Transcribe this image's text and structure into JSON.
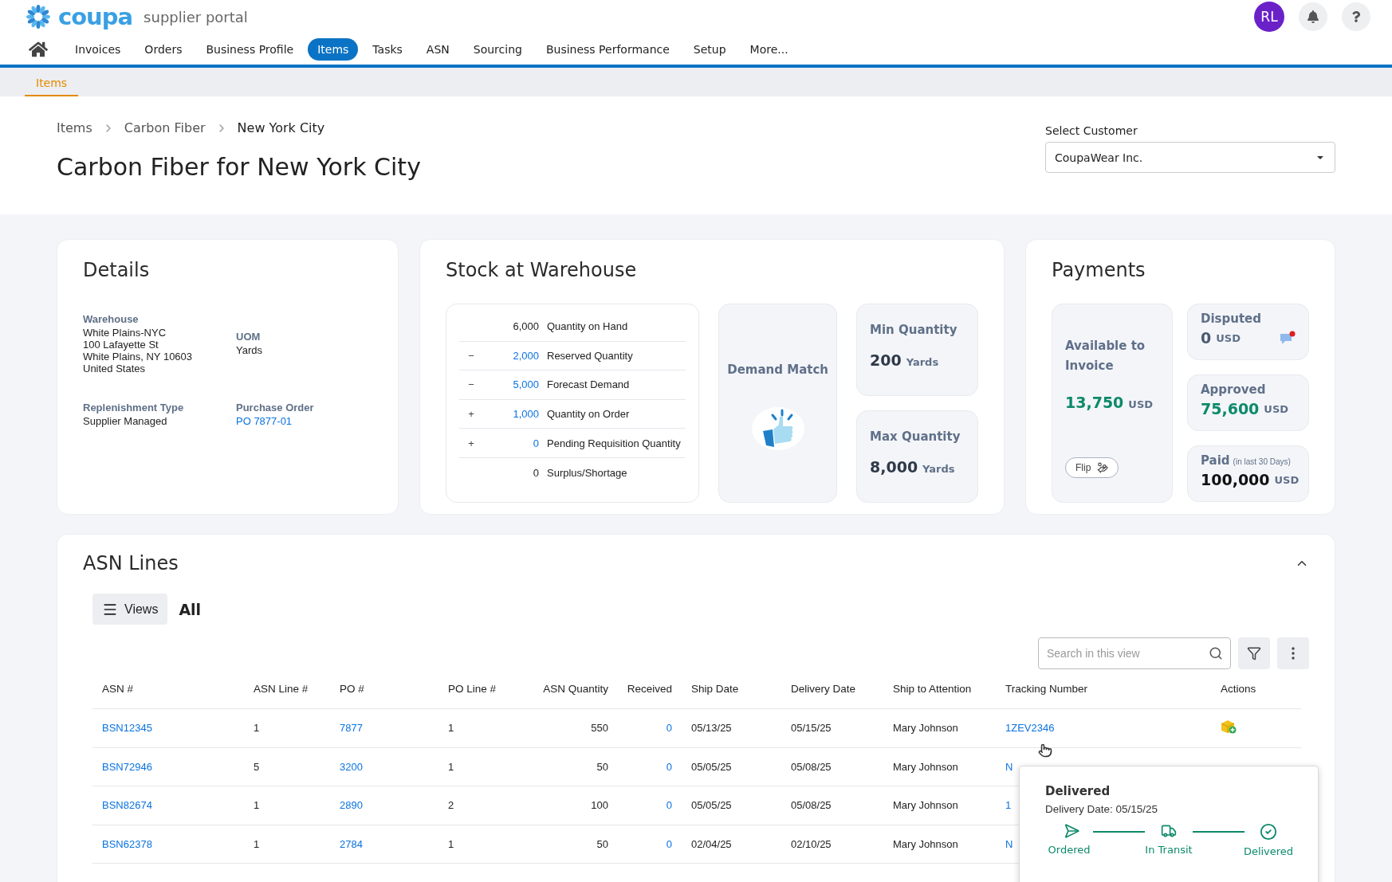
{
  "header": {
    "logo": "coupa",
    "product": "supplier portal",
    "avatar": "RL"
  },
  "nav": [
    {
      "label": "Invoices",
      "selected": false
    },
    {
      "label": "Orders",
      "selected": false
    },
    {
      "label": "Business Profile",
      "selected": false
    },
    {
      "label": "Items",
      "selected": true
    },
    {
      "label": "Tasks",
      "selected": false
    },
    {
      "label": "ASN",
      "selected": false
    },
    {
      "label": "Sourcing",
      "selected": false
    },
    {
      "label": "Business Performance",
      "selected": false
    },
    {
      "label": "Setup",
      "selected": false
    },
    {
      "label": "More...",
      "selected": false
    }
  ],
  "subnav": [
    {
      "label": "Items",
      "selected": true
    }
  ],
  "breadcrumbs": [
    "Items",
    "Carbon Fiber",
    "New York City"
  ],
  "title": "Carbon Fiber for New York City",
  "customer_select": {
    "label": "Select Customer",
    "value": "CoupaWear Inc."
  },
  "details": {
    "title": "Details",
    "fields": [
      {
        "label": "Warehouse",
        "kind": "text",
        "lines": [
          "White Plains-NYC",
          "100 Lafayette St",
          "White Plains, NY 10603",
          "United States"
        ]
      },
      {
        "label": "UOM",
        "kind": "text",
        "lines": [
          "Yards"
        ]
      },
      {
        "label": "Replenishment Type",
        "kind": "text",
        "lines": [
          "Supplier Managed"
        ]
      },
      {
        "label": "Purchase Order",
        "kind": "link",
        "lines": [
          "PO 7877-01"
        ]
      }
    ]
  },
  "stock": {
    "title": "Stock at Warehouse",
    "rows": [
      {
        "value": "6,000",
        "label": "Quantity on Hand",
        "kind": "plain"
      },
      {
        "sign": "−",
        "value": "2,000",
        "label": "Reserved Quantity",
        "kind": "link"
      },
      {
        "sign": "−",
        "value": "5,000",
        "label": "Forecast Demand",
        "kind": "link"
      },
      {
        "sign": "+",
        "value": "1,000",
        "label": "Quantity on Order",
        "kind": "link"
      },
      {
        "sign": "+",
        "value": "0",
        "label": "Pending Requisition Quantity",
        "kind": "link"
      },
      {
        "value": "0",
        "label": "Surplus/Shortage",
        "kind": "plain"
      }
    ],
    "demand_match": {
      "label": "Demand Match"
    },
    "limits": [
      {
        "label": "Min Quantity",
        "value": "200",
        "unit": "Yards"
      },
      {
        "label": "Max Quantity",
        "value": "8,000",
        "unit": "Yards"
      }
    ]
  },
  "payments": {
    "title": "Payments",
    "available": {
      "label": "Available to Invoice",
      "value": "13,750",
      "unit": "USD",
      "button": "Flip"
    },
    "tiles": [
      {
        "label": "Disputed",
        "value": "0",
        "unit": "USD",
        "kind": "disputed"
      },
      {
        "label": "Approved",
        "value": "75,600",
        "unit": "USD",
        "kind": "approved"
      },
      {
        "label": "Paid",
        "note": "(in last 30 Days)",
        "value": "100,000",
        "unit": "USD",
        "kind": "paid"
      }
    ]
  },
  "asn": {
    "title": "ASN Lines",
    "expanded": true,
    "views_button": "Views",
    "view_name": "All",
    "search": {
      "placeholder": "Search in this view"
    },
    "columns": [
      "ASN #",
      "ASN Line #",
      "PO #",
      "PO Line #",
      "ASN Quantity",
      "Received",
      "Ship Date",
      "Delivery Date",
      "Ship to Attention",
      "Tracking Number",
      "Actions"
    ],
    "rows": [
      {
        "cells": [
          "BSN12345",
          "1",
          "7877",
          "1",
          "550",
          "0",
          "05/13/25",
          "05/15/25",
          "Mary Johnson",
          "1ZEV2346"
        ],
        "action": true
      },
      {
        "cells": [
          "BSN72946",
          "5",
          "3200",
          "1",
          "50",
          "0",
          "05/05/25",
          "05/08/25",
          "Mary Johnson",
          "N"
        ],
        "action": false
      },
      {
        "cells": [
          "BSN82674",
          "1",
          "2890",
          "2",
          "100",
          "0",
          "05/05/25",
          "05/08/25",
          "Mary Johnson",
          "1"
        ],
        "action": false
      },
      {
        "cells": [
          "BSN62378",
          "1",
          "2784",
          "1",
          "50",
          "0",
          "02/04/25",
          "02/10/25",
          "Mary Johnson",
          "N"
        ],
        "action": false
      }
    ],
    "popover": {
      "title": "Delivered",
      "date": "Delivery Date: 05/15/25",
      "steps": [
        {
          "label": "Ordered",
          "kind": "ordered"
        },
        {
          "label": "In Transit",
          "kind": "transit"
        },
        {
          "label": "Delivered",
          "kind": "delivered"
        }
      ]
    }
  }
}
